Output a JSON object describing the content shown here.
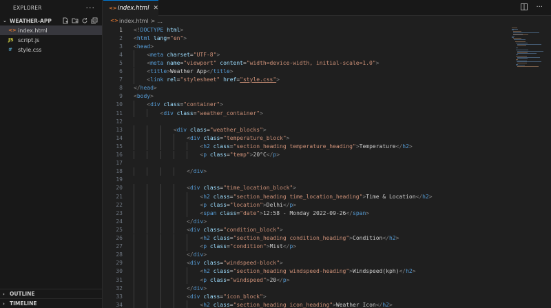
{
  "sidebar": {
    "title": "EXPLORER",
    "more": "···",
    "folder": "WEATHER-APP",
    "files": [
      {
        "icon": "<>",
        "name": "index.html",
        "type": "html",
        "active": true
      },
      {
        "icon": "JS",
        "name": "script.js",
        "type": "js",
        "active": false
      },
      {
        "icon": "#",
        "name": "style.css",
        "type": "css",
        "active": false
      }
    ],
    "outline": "OUTLINE",
    "timeline": "TIMELINE"
  },
  "tab": {
    "icon": "<>",
    "name": "index.html",
    "close": "✕"
  },
  "breadcrumb": {
    "icon": "<>",
    "file": "index.html",
    "sep": ">",
    "rest": "..."
  },
  "editor": {
    "current_line": 1,
    "lines": [
      {
        "n": "1",
        "indent": 0,
        "tokens": [
          [
            "br",
            "<!"
          ],
          [
            "tag",
            "DOCTYPE"
          ],
          [
            "attr",
            " html"
          ],
          [
            "br",
            ">"
          ]
        ]
      },
      {
        "n": "2",
        "indent": 0,
        "tokens": [
          [
            "br",
            "<"
          ],
          [
            "tag",
            "html"
          ],
          [
            "attr",
            " lang"
          ],
          [
            "txt",
            "="
          ],
          [
            "str",
            "\"en\""
          ],
          [
            "br",
            ">"
          ]
        ]
      },
      {
        "n": "3",
        "indent": 0,
        "tokens": [
          [
            "br",
            "<"
          ],
          [
            "tag",
            "head"
          ],
          [
            "br",
            ">"
          ]
        ]
      },
      {
        "n": "4",
        "indent": 1,
        "tokens": [
          [
            "br",
            "<"
          ],
          [
            "tag",
            "meta"
          ],
          [
            "attr",
            " charset"
          ],
          [
            "txt",
            "="
          ],
          [
            "str",
            "\"UTF-8\""
          ],
          [
            "br",
            ">"
          ]
        ]
      },
      {
        "n": "5",
        "indent": 1,
        "tokens": [
          [
            "br",
            "<"
          ],
          [
            "tag",
            "meta"
          ],
          [
            "attr",
            " name"
          ],
          [
            "txt",
            "="
          ],
          [
            "str",
            "\"viewport\""
          ],
          [
            "attr",
            " content"
          ],
          [
            "txt",
            "="
          ],
          [
            "str",
            "\"width=device-width, initial-scale=1.0\""
          ],
          [
            "br",
            ">"
          ]
        ]
      },
      {
        "n": "6",
        "indent": 1,
        "tokens": [
          [
            "br",
            "<"
          ],
          [
            "tag",
            "title"
          ],
          [
            "br",
            ">"
          ],
          [
            "txt",
            "Weather App"
          ],
          [
            "br",
            "</"
          ],
          [
            "tag",
            "title"
          ],
          [
            "br",
            ">"
          ]
        ]
      },
      {
        "n": "7",
        "indent": 1,
        "tokens": [
          [
            "br",
            "<"
          ],
          [
            "tag",
            "link"
          ],
          [
            "attr",
            " rel"
          ],
          [
            "txt",
            "="
          ],
          [
            "str",
            "\"stylesheet\""
          ],
          [
            "attr",
            " href"
          ],
          [
            "txt",
            "="
          ],
          [
            "link",
            "\"style.css\""
          ],
          [
            "br",
            ">"
          ]
        ]
      },
      {
        "n": "8",
        "indent": 0,
        "tokens": [
          [
            "br",
            "</"
          ],
          [
            "tag",
            "head"
          ],
          [
            "br",
            ">"
          ]
        ]
      },
      {
        "n": "9",
        "indent": 0,
        "tokens": [
          [
            "br",
            "<"
          ],
          [
            "tag",
            "body"
          ],
          [
            "br",
            ">"
          ]
        ]
      },
      {
        "n": "10",
        "indent": 1,
        "tokens": [
          [
            "br",
            "<"
          ],
          [
            "tag",
            "div"
          ],
          [
            "attr",
            " class"
          ],
          [
            "txt",
            "="
          ],
          [
            "str",
            "\"container\""
          ],
          [
            "br",
            ">"
          ]
        ]
      },
      {
        "n": "11",
        "indent": 2,
        "tokens": [
          [
            "br",
            "<"
          ],
          [
            "tag",
            "div"
          ],
          [
            "attr",
            " class"
          ],
          [
            "txt",
            "="
          ],
          [
            "str",
            "\"weather_container\""
          ],
          [
            "br",
            ">"
          ]
        ]
      },
      {
        "n": "12",
        "indent": 0,
        "tokens": []
      },
      {
        "n": "13",
        "indent": 3,
        "tokens": [
          [
            "br",
            "<"
          ],
          [
            "tag",
            "div"
          ],
          [
            "attr",
            " class"
          ],
          [
            "txt",
            "="
          ],
          [
            "str",
            "\"weather_blocks\""
          ],
          [
            "br",
            ">"
          ]
        ]
      },
      {
        "n": "14",
        "indent": 4,
        "tokens": [
          [
            "br",
            "<"
          ],
          [
            "tag",
            "div"
          ],
          [
            "attr",
            " class"
          ],
          [
            "txt",
            "="
          ],
          [
            "str",
            "\"temperature_block\""
          ],
          [
            "br",
            ">"
          ]
        ]
      },
      {
        "n": "15",
        "indent": 5,
        "tokens": [
          [
            "br",
            "<"
          ],
          [
            "tag",
            "h2"
          ],
          [
            "attr",
            " class"
          ],
          [
            "txt",
            "="
          ],
          [
            "str",
            "\"section_heading temperature_heading\""
          ],
          [
            "br",
            ">"
          ],
          [
            "txt",
            "Temperature"
          ],
          [
            "br",
            "</"
          ],
          [
            "tag",
            "h2"
          ],
          [
            "br",
            ">"
          ]
        ]
      },
      {
        "n": "16",
        "indent": 5,
        "tokens": [
          [
            "br",
            "<"
          ],
          [
            "tag",
            "p"
          ],
          [
            "attr",
            " class"
          ],
          [
            "txt",
            "="
          ],
          [
            "str",
            "\"temp\""
          ],
          [
            "br",
            ">"
          ],
          [
            "txt",
            "20°C"
          ],
          [
            "br",
            "</"
          ],
          [
            "tag",
            "p"
          ],
          [
            "br",
            ">"
          ]
        ]
      },
      {
        "n": "17",
        "indent": 0,
        "tokens": []
      },
      {
        "n": "18",
        "indent": 4,
        "tokens": [
          [
            "br",
            "</"
          ],
          [
            "tag",
            "div"
          ],
          [
            "br",
            ">"
          ]
        ]
      },
      {
        "n": "19",
        "indent": 0,
        "tokens": []
      },
      {
        "n": "20",
        "indent": 4,
        "tokens": [
          [
            "br",
            "<"
          ],
          [
            "tag",
            "div"
          ],
          [
            "attr",
            " class"
          ],
          [
            "txt",
            "="
          ],
          [
            "str",
            "\"time_location_block\""
          ],
          [
            "br",
            ">"
          ]
        ]
      },
      {
        "n": "21",
        "indent": 5,
        "tokens": [
          [
            "br",
            "<"
          ],
          [
            "tag",
            "h2"
          ],
          [
            "attr",
            " class"
          ],
          [
            "txt",
            "="
          ],
          [
            "str",
            "\"section_heading time_location_heading\""
          ],
          [
            "br",
            ">"
          ],
          [
            "txt",
            "Time & Location"
          ],
          [
            "br",
            "</"
          ],
          [
            "tag",
            "h2"
          ],
          [
            "br",
            ">"
          ]
        ]
      },
      {
        "n": "22",
        "indent": 5,
        "tokens": [
          [
            "br",
            "<"
          ],
          [
            "tag",
            "p"
          ],
          [
            "attr",
            " class"
          ],
          [
            "txt",
            "="
          ],
          [
            "str",
            "\"location\""
          ],
          [
            "br",
            ">"
          ],
          [
            "txt",
            "Delhi"
          ],
          [
            "br",
            "</"
          ],
          [
            "tag",
            "p"
          ],
          [
            "br",
            ">"
          ]
        ]
      },
      {
        "n": "23",
        "indent": 5,
        "tokens": [
          [
            "br",
            "<"
          ],
          [
            "tag",
            "span"
          ],
          [
            "attr",
            " class"
          ],
          [
            "txt",
            "="
          ],
          [
            "str",
            "\"date\""
          ],
          [
            "br",
            ">"
          ],
          [
            "txt",
            "12:58 - Monday 2022-09-26"
          ],
          [
            "br",
            "</"
          ],
          [
            "tag",
            "span"
          ],
          [
            "br",
            ">"
          ]
        ]
      },
      {
        "n": "24",
        "indent": 4,
        "tokens": [
          [
            "br",
            "</"
          ],
          [
            "tag",
            "div"
          ],
          [
            "br",
            ">"
          ]
        ]
      },
      {
        "n": "25",
        "indent": 4,
        "tokens": [
          [
            "br",
            "<"
          ],
          [
            "tag",
            "div"
          ],
          [
            "attr",
            " class"
          ],
          [
            "txt",
            "="
          ],
          [
            "str",
            "\"condition_block\""
          ],
          [
            "br",
            ">"
          ]
        ]
      },
      {
        "n": "26",
        "indent": 5,
        "tokens": [
          [
            "br",
            "<"
          ],
          [
            "tag",
            "h2"
          ],
          [
            "attr",
            " class"
          ],
          [
            "txt",
            "="
          ],
          [
            "str",
            "\"section_heading condition_heading\""
          ],
          [
            "br",
            ">"
          ],
          [
            "txt",
            "Condition"
          ],
          [
            "br",
            "</"
          ],
          [
            "tag",
            "h2"
          ],
          [
            "br",
            ">"
          ]
        ]
      },
      {
        "n": "27",
        "indent": 5,
        "tokens": [
          [
            "br",
            "<"
          ],
          [
            "tag",
            "p"
          ],
          [
            "attr",
            " class"
          ],
          [
            "txt",
            "="
          ],
          [
            "str",
            "\"condition\""
          ],
          [
            "br",
            ">"
          ],
          [
            "txt",
            "Mist"
          ],
          [
            "br",
            "</"
          ],
          [
            "tag",
            "p"
          ],
          [
            "br",
            ">"
          ]
        ]
      },
      {
        "n": "28",
        "indent": 4,
        "tokens": [
          [
            "br",
            "</"
          ],
          [
            "tag",
            "div"
          ],
          [
            "br",
            ">"
          ]
        ]
      },
      {
        "n": "29",
        "indent": 4,
        "tokens": [
          [
            "br",
            "<"
          ],
          [
            "tag",
            "div"
          ],
          [
            "attr",
            " class"
          ],
          [
            "txt",
            "="
          ],
          [
            "str",
            "\"windspeed-block\""
          ],
          [
            "br",
            ">"
          ]
        ]
      },
      {
        "n": "30",
        "indent": 5,
        "tokens": [
          [
            "br",
            "<"
          ],
          [
            "tag",
            "h2"
          ],
          [
            "attr",
            " class"
          ],
          [
            "txt",
            "="
          ],
          [
            "str",
            "\"section_heading windspeed-heading\""
          ],
          [
            "br",
            ">"
          ],
          [
            "txt",
            "Windspeed(kph)"
          ],
          [
            "br",
            "</"
          ],
          [
            "tag",
            "h2"
          ],
          [
            "br",
            ">"
          ]
        ]
      },
      {
        "n": "31",
        "indent": 5,
        "tokens": [
          [
            "br",
            "<"
          ],
          [
            "tag",
            "p"
          ],
          [
            "attr",
            " class"
          ],
          [
            "txt",
            "="
          ],
          [
            "str",
            "\"windspeed\""
          ],
          [
            "br",
            ">"
          ],
          [
            "txt",
            "20"
          ],
          [
            "br",
            "</"
          ],
          [
            "tag",
            "p"
          ],
          [
            "br",
            ">"
          ]
        ]
      },
      {
        "n": "32",
        "indent": 4,
        "tokens": [
          [
            "br",
            "</"
          ],
          [
            "tag",
            "div"
          ],
          [
            "br",
            ">"
          ]
        ]
      },
      {
        "n": "33",
        "indent": 4,
        "tokens": [
          [
            "br",
            "<"
          ],
          [
            "tag",
            "div"
          ],
          [
            "attr",
            " class"
          ],
          [
            "txt",
            "="
          ],
          [
            "str",
            "\"icon_block\""
          ],
          [
            "br",
            ">"
          ]
        ]
      },
      {
        "n": "34",
        "indent": 5,
        "tokens": [
          [
            "br",
            "<"
          ],
          [
            "tag",
            "h2"
          ],
          [
            "attr",
            " class"
          ],
          [
            "txt",
            "="
          ],
          [
            "str",
            "\"section_heading icon_heading\""
          ],
          [
            "br",
            ">"
          ],
          [
            "txt",
            "Weather Icon"
          ],
          [
            "br",
            "</"
          ],
          [
            "tag",
            "h2"
          ],
          [
            "br",
            ">"
          ]
        ]
      }
    ]
  }
}
